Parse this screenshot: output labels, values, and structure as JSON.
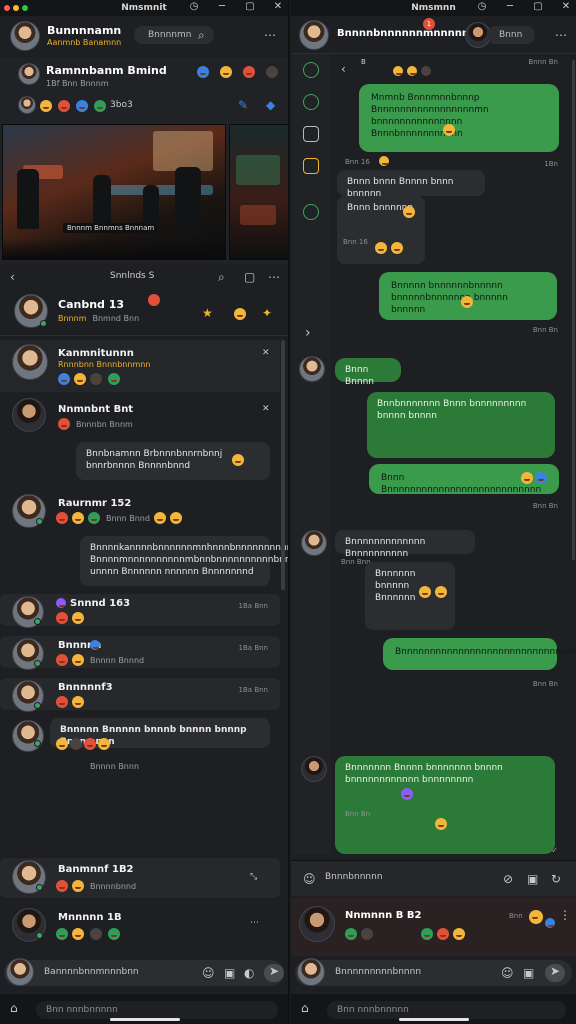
{
  "left": {
    "window_title": "Nmsmnit",
    "header": {
      "name": "Bunnnnamn",
      "sub": "Aanmnb Banamnn",
      "search_placeholder": "Bnnnnmn"
    },
    "stream": {
      "host": "Ramnnbanm Bmind",
      "meta": "1Bf Bnn Bnnnm",
      "view_count": "3bo3",
      "caption": "Bnnnm Bnnmns Bnnnam"
    },
    "conversation": {
      "nav_title": "Snnlnds S",
      "header_name": "Canbnd 13",
      "header_tag": "Bnnnm",
      "header_sub": "Bnmnd Bnn"
    },
    "messages": [
      {
        "name": "Kanmnitunnn",
        "meta": "Rnnnbnn Bnnnbnnmnn",
        "time": ""
      },
      {
        "name": "Nnmnbnt Bnt",
        "meta": "Bnnnbn Bnnm",
        "bubble": "Bnnbnamnn Brbnnnbnnrnbnnj bnnrbnnnn Bnnnnbnnd",
        "time": ""
      },
      {
        "name": "Raurnmr 152",
        "meta": "Bnnn Bnnd",
        "bubble": "Bnnnnkannnnbnnnnnnmnhnnnbnnnnnnnnnm Bnnnnmnnnnnnnnnnmbnnbnnnnnnnnnnbnnnnnnnn unnnn Bnnnnnn nnnnnn Bnnnnnnnd",
        "time": ""
      },
      {
        "name": "Snnnd 163",
        "meta": "",
        "time": "1Ba Bnn"
      },
      {
        "name": "Bnnnnn",
        "meta": "Bnnnn Bnnnd",
        "time": "1Ba Bnn"
      },
      {
        "name": "Bnnnnnf3",
        "meta": "",
        "time": "1Ba Bnn"
      },
      {
        "name": "Bnnnnn Bnnnnn bnnnb bnnnn bnnnp Bnnnmnnn",
        "meta": "Bnnnn Bnnn",
        "time": ""
      },
      {
        "name": "Banmnnf 1B2",
        "meta": "Bnnnnbnnd",
        "time": ""
      },
      {
        "name": "Mnnnnn 1B",
        "meta": "",
        "time": ""
      }
    ],
    "composer_placeholder": "Bannnnbnnmnnnbnn",
    "bottom_placeholder": "Bnn nnnbnnnnn"
  },
  "right": {
    "window_title": "Nmsmnn",
    "header": {
      "name": "Bnnnnbnnnnnnmnnnnnnnl",
      "badge": "1",
      "action": "Bnnn"
    },
    "messages": [
      {
        "side": "right",
        "text": "Mnmnb Bnnnmnnbnnnp Bnnnnnnnnnnnnnnnnnmn bnnnnnnnnnnnnnnn Bnnnbnnnnnnnnnnn",
        "ts": "Bnnn Bn"
      },
      {
        "side": "left",
        "text": "Bnnn bnnn Bnnnn bnnn bnnnnn",
        "ts": "Bnn 16"
      },
      {
        "side": "left",
        "text": "Bnnn bnnnnnn",
        "ts": "Bnn 16"
      },
      {
        "side": "right",
        "text": "Bnnnnn bnnnnnnbnnnnn bnnnnnbnnnnnnn bnnnnn bnnnnn",
        "ts": "Bnn Bn"
      },
      {
        "side": "left",
        "text": "Bnnn Bnnnn",
        "ts": ""
      },
      {
        "side": "right-dark",
        "text": "Bnnbnnnnnnn Bnnn bnnnnnnnnn bnnnn bnnnn",
        "ts": ""
      },
      {
        "side": "right",
        "text": "Bnnn Bnnnnnnnnnnnnnnnnnnnnnnnnnnn",
        "ts": "Bnn Bn"
      },
      {
        "side": "left",
        "text": "Bnnnnnnnnnnnnn Bnnnnnnnnnn",
        "ts": "Bnn Bnn"
      },
      {
        "side": "left",
        "text": "Bnnnnnn bnnnnn Bnnnnnn",
        "ts": ""
      },
      {
        "side": "right",
        "text": "Bnnnnnnnnnnnnnnnnnnnnnnnnnnnnnnnnn",
        "ts": "Bnn Bn"
      },
      {
        "side": "right-dark",
        "text": "Bnnnnnnn Bnnnn bnnnnnnn bnnnn bnnnnnnnnnnnn bnnnnnnnn",
        "ts": "Bnn Bn"
      }
    ],
    "composer_placeholder": "Bnnnbnnnnn",
    "notif": {
      "name": "Nnmnnn B B2",
      "time": "Bnn"
    },
    "bottom_composer_placeholder": "Bnnnnnnnnnbnnnn",
    "bottom_placeholder": "Bnn nnnbnnnnn"
  },
  "colors": {
    "accent_green": "#3ba55c",
    "bubble_green": "#3a9b4c",
    "bg": "#1e1f22",
    "warning": "#f0b429"
  }
}
